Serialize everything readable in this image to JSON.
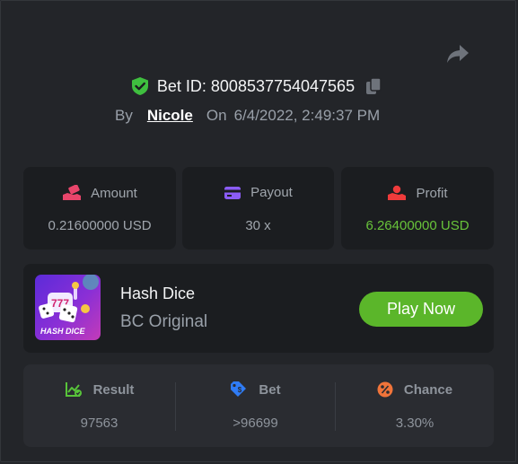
{
  "header": {
    "bet_id_label": "Bet ID: 8008537754047565",
    "by_label": "By",
    "username": "Nicole",
    "on_label": "On",
    "datetime": "6/4/2022, 2:49:37 PM"
  },
  "stats": {
    "amount": {
      "label": "Amount",
      "value": "0.21600000 USD",
      "icon": "money-hand-icon"
    },
    "payout": {
      "label": "Payout",
      "value": "30 x",
      "icon": "card-icon"
    },
    "profit": {
      "label": "Profit",
      "value": "6.26400000 USD",
      "icon": "profit-hand-icon"
    }
  },
  "game": {
    "name": "Hash Dice",
    "subtitle": "BC Original",
    "thumb_text": "HASH DICE",
    "play_label": "Play Now"
  },
  "result": {
    "result": {
      "label": "Result",
      "value": "97563"
    },
    "bet": {
      "label": "Bet",
      "value": ">96699"
    },
    "chance": {
      "label": "Chance",
      "value": "3.30%"
    }
  },
  "colors": {
    "background": "#232529",
    "card": "#1b1d20",
    "accent_green": "#5bb62a",
    "profit_green": "#68c33a",
    "pink_icon": "#e8456b",
    "purple_icon": "#8b5cf6",
    "red_icon": "#ef3b3b",
    "blue_icon": "#2f7cf6",
    "orange_icon": "#f0743a"
  }
}
